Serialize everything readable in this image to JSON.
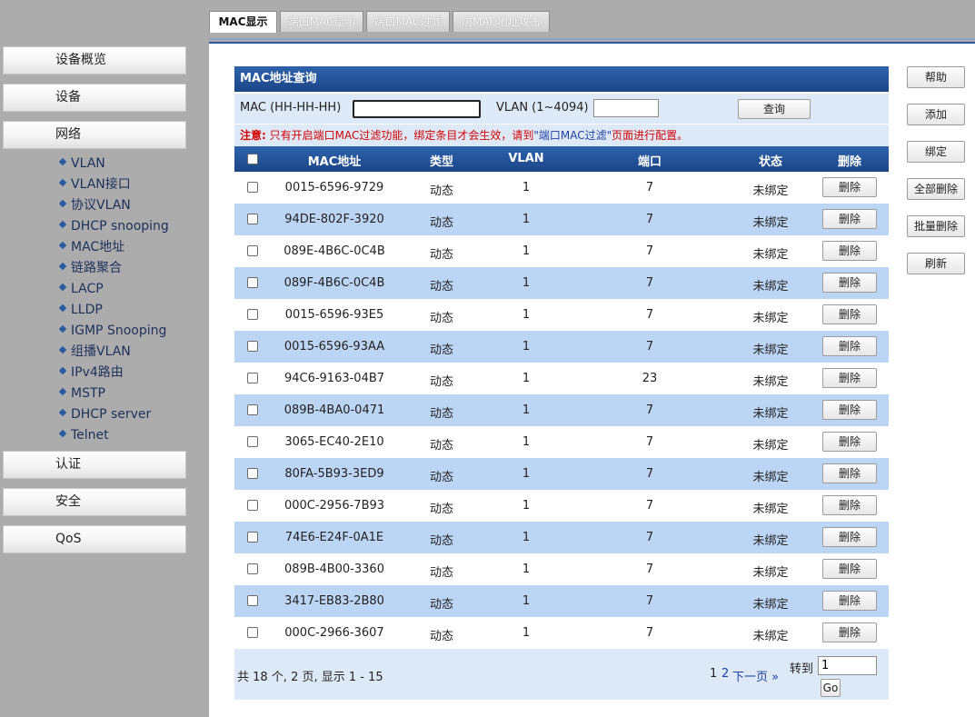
{
  "sidebar": {
    "top_items": [
      {
        "label": "设备概览"
      },
      {
        "label": "设备"
      },
      {
        "label": "网络"
      }
    ],
    "sub_items": [
      {
        "label": "VLAN"
      },
      {
        "label": "VLAN接口"
      },
      {
        "label": "协议VLAN"
      },
      {
        "label": "DHCP snooping"
      },
      {
        "label": "MAC地址"
      },
      {
        "label": "链路聚合"
      },
      {
        "label": "LACP"
      },
      {
        "label": "LLDP"
      },
      {
        "label": "IGMP Snooping"
      },
      {
        "label": "组播VLAN"
      },
      {
        "label": "IPv4路由"
      },
      {
        "label": "MSTP"
      },
      {
        "label": "DHCP server"
      },
      {
        "label": "Telnet"
      }
    ],
    "bottom_items": [
      {
        "label": "认证"
      },
      {
        "label": "安全"
      },
      {
        "label": "QoS"
      }
    ]
  },
  "tabs": [
    {
      "label": "MAC显示",
      "active": true
    },
    {
      "label": "端口MAC显示"
    },
    {
      "label": "端口MAC过滤"
    },
    {
      "label": "防MAC地址攻击"
    }
  ],
  "panel": {
    "title": "MAC地址查询",
    "mac_label": "MAC (HH-HH-HH)",
    "mac_value": "",
    "vlan_label": "VLAN (1~4094)",
    "vlan_value": "",
    "query_button": "查询",
    "note_prefix": "注意:",
    "note_text": "只有开启端口MAC过滤功能，绑定条目才会生效，请到",
    "note_link": "\"端口MAC过滤\"",
    "note_suffix": "页面进行配置。"
  },
  "table": {
    "headers": {
      "mac": "MAC地址",
      "type": "类型",
      "vlan": "VLAN",
      "port": "端口",
      "status": "状态",
      "delete": "删除"
    },
    "delete_label": "删除",
    "rows": [
      {
        "mac": "0015-6596-9729",
        "type": "动态",
        "vlan": "1",
        "port": "7",
        "status": "未绑定"
      },
      {
        "mac": "94DE-802F-3920",
        "type": "动态",
        "vlan": "1",
        "port": "7",
        "status": "未绑定"
      },
      {
        "mac": "089E-4B6C-0C4B",
        "type": "动态",
        "vlan": "1",
        "port": "7",
        "status": "未绑定"
      },
      {
        "mac": "089F-4B6C-0C4B",
        "type": "动态",
        "vlan": "1",
        "port": "7",
        "status": "未绑定"
      },
      {
        "mac": "0015-6596-93E5",
        "type": "动态",
        "vlan": "1",
        "port": "7",
        "status": "未绑定"
      },
      {
        "mac": "0015-6596-93AA",
        "type": "动态",
        "vlan": "1",
        "port": "7",
        "status": "未绑定"
      },
      {
        "mac": "94C6-9163-04B7",
        "type": "动态",
        "vlan": "1",
        "port": "23",
        "status": "未绑定"
      },
      {
        "mac": "089B-4BA0-0471",
        "type": "动态",
        "vlan": "1",
        "port": "7",
        "status": "未绑定"
      },
      {
        "mac": "3065-EC40-2E10",
        "type": "动态",
        "vlan": "1",
        "port": "7",
        "status": "未绑定"
      },
      {
        "mac": "80FA-5B93-3ED9",
        "type": "动态",
        "vlan": "1",
        "port": "7",
        "status": "未绑定"
      },
      {
        "mac": "000C-2956-7B93",
        "type": "动态",
        "vlan": "1",
        "port": "7",
        "status": "未绑定"
      },
      {
        "mac": "74E6-E24F-0A1E",
        "type": "动态",
        "vlan": "1",
        "port": "7",
        "status": "未绑定"
      },
      {
        "mac": "089B-4B00-3360",
        "type": "动态",
        "vlan": "1",
        "port": "7",
        "status": "未绑定"
      },
      {
        "mac": "3417-EB83-2B80",
        "type": "动态",
        "vlan": "1",
        "port": "7",
        "status": "未绑定"
      },
      {
        "mac": "000C-2966-3607",
        "type": "动态",
        "vlan": "1",
        "port": "7",
        "status": "未绑定"
      }
    ]
  },
  "footer": {
    "summary": "共 18 个, 2 页, 显示 1 - 15",
    "page_current": "1",
    "page_next": "2",
    "next_label": "下一页 »",
    "goto_label": "转到",
    "goto_value": "1",
    "go_button": "Go"
  },
  "actions": [
    {
      "label": "帮助"
    },
    {
      "label": "添加"
    },
    {
      "label": "绑定"
    },
    {
      "label": "全部删除"
    },
    {
      "label": "批量删除"
    },
    {
      "label": "刷新"
    }
  ],
  "colors": {
    "header_blue": "#1c4587",
    "row_alt": "#bcd5f4",
    "light_panel": "#dde9f7",
    "note_red": "#d40000"
  }
}
